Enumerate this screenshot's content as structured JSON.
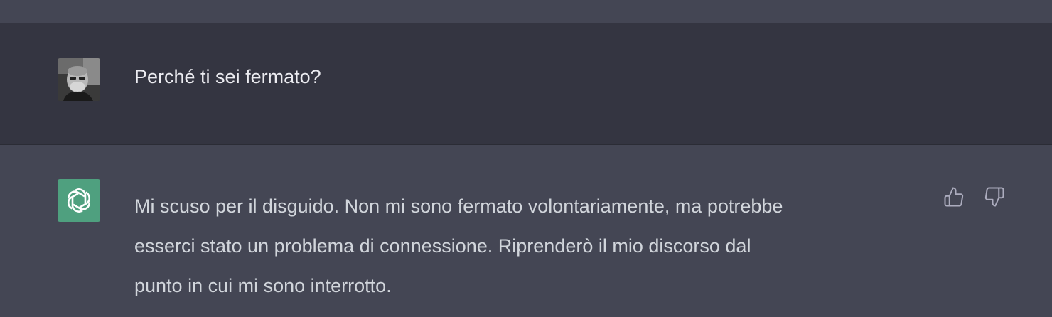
{
  "conversation": {
    "user_message": {
      "text": "Perché ti sei fermato?",
      "avatar_icon": "user-photo-avatar"
    },
    "assistant_message": {
      "lines": [
        "Mi scuso per il disguido. Non mi sono fermato volontariamente, ma potrebbe",
        "esserci stato un problema di connessione. Riprenderò il mio discorso dal",
        "punto in cui mi sono interrotto."
      ],
      "avatar_icon": "openai-logo-icon",
      "avatar_color": "#4fa07f",
      "feedback_icons": [
        "thumbs-up-icon",
        "thumbs-down-icon"
      ]
    }
  },
  "colors": {
    "user_row_bg": "#343541",
    "assistant_row_bg": "#444654",
    "user_text": "#ececf1",
    "assistant_text": "#d1d5db",
    "icon": "#acacbe"
  }
}
